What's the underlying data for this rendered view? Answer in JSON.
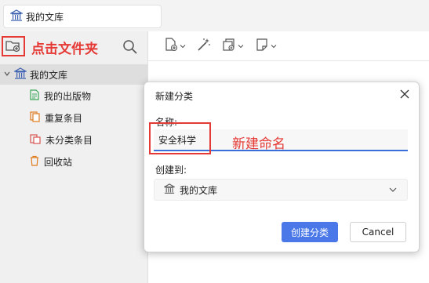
{
  "tab": {
    "title": "我的文库",
    "icon": "library-icon"
  },
  "sidebar": {
    "annotation": "点击文件夹",
    "root": {
      "label": "我的文库",
      "icon": "library-icon"
    },
    "items": [
      {
        "label": "我的出版物",
        "icon": "document-green-icon"
      },
      {
        "label": "重复条目",
        "icon": "duplicate-icon"
      },
      {
        "label": "未分类条目",
        "icon": "unfiled-icon"
      },
      {
        "label": "回收站",
        "icon": "trash-icon"
      }
    ]
  },
  "dialog": {
    "title": "新建分类",
    "name_label": "名称:",
    "name_value": "安全科学",
    "annotation": "新建命名",
    "create_in_label": "创建到:",
    "create_in_value": "我的文库",
    "create_button": "创建分类",
    "cancel_button": "Cancel"
  },
  "colors": {
    "accent": "#4a78e8",
    "annotation": "#e53935"
  }
}
